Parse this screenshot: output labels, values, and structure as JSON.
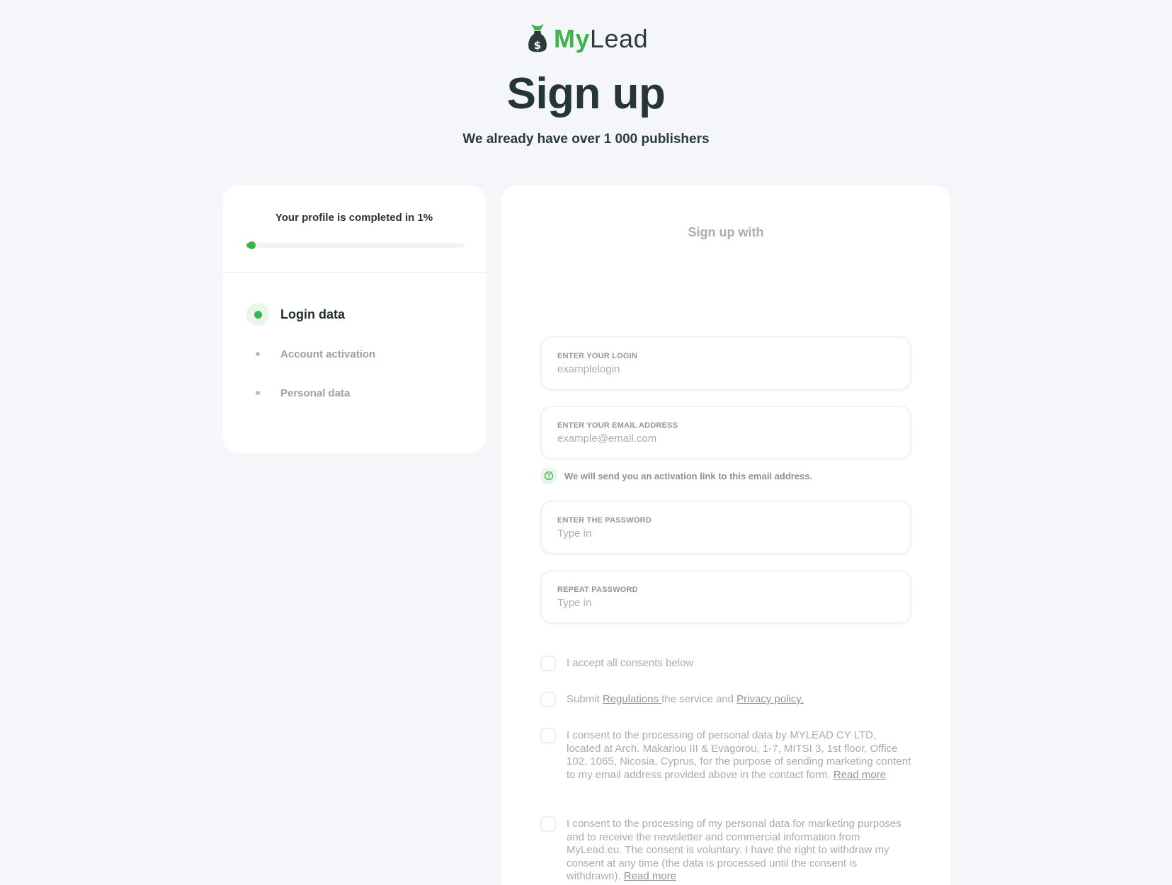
{
  "brand": {
    "name_part1": "My",
    "name_part2": "Lead",
    "color": "#3bb54a",
    "icon": "money-bag-icon"
  },
  "header": {
    "title": "Sign up",
    "subtitle": "We already have over 1 000 publishers"
  },
  "progress": {
    "label": "Your profile is completed in 1%",
    "percent": 1
  },
  "steps": [
    {
      "label": "Login data",
      "state": "active"
    },
    {
      "label": "Account activation",
      "state": "pending"
    },
    {
      "label": "Personal data",
      "state": "pending"
    }
  ],
  "form": {
    "signup_with": "Sign up with",
    "login": {
      "label": "ENTER YOUR LOGIN",
      "placeholder": "examplelogin"
    },
    "email": {
      "label": "ENTER YOUR EMAIL ADDRESS",
      "placeholder": "example@email.com"
    },
    "email_hint": "We will send you an activation link to this email address.",
    "password": {
      "label": "ENTER THE PASSWORD",
      "placeholder": "Type in"
    },
    "repeat_password": {
      "label": "REPEAT PASSWORD",
      "placeholder": "Type in"
    }
  },
  "consents": {
    "accept_all": "I accept all consents below",
    "regulations": {
      "prefix": "Submit ",
      "link1": "Regulations ",
      "middle": "the service and ",
      "link2": "Privacy policy."
    },
    "processing": {
      "text": "I consent to the processing of personal data by MYLEAD CY LTD, located at Arch. Makariou III & Evagorou, 1-7, MITSI 3, 1st floor, Office 102, 1065, Nicosia, Cyprus, for the purpose of sending marketing content to my email address provided above in the contact form. ",
      "link": "Read more"
    },
    "marketing": {
      "text": "I consent to the processing of my personal data for marketing purposes and to receive the newsletter and commercial information from MyLead.eu. The consent is voluntary. I have the right to withdraw my consent at any time (the data is processed until the consent is withdrawn). ",
      "link": "Read more"
    }
  }
}
